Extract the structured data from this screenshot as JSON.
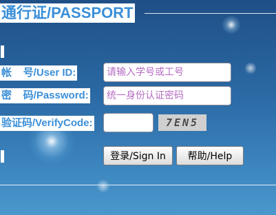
{
  "header": {
    "title": "通行证/PASSPORT"
  },
  "form": {
    "userid": {
      "label": "帐    号/User ID:",
      "placeholder": "请输入学号或工号",
      "value": ""
    },
    "password": {
      "label": "密    码/Password:",
      "placeholder": "统一身份认证密码",
      "value": ""
    },
    "verify": {
      "label": "验证码/VerifyCode:",
      "value": "",
      "captcha_text": "7EN5"
    }
  },
  "buttons": {
    "login_label": "登录/Sign In",
    "help_label": "帮助/Help"
  },
  "colors": {
    "label_blue": "#3a8fd8",
    "placeholder_purple": "#b56cc2",
    "background": "#2b6aa5"
  }
}
